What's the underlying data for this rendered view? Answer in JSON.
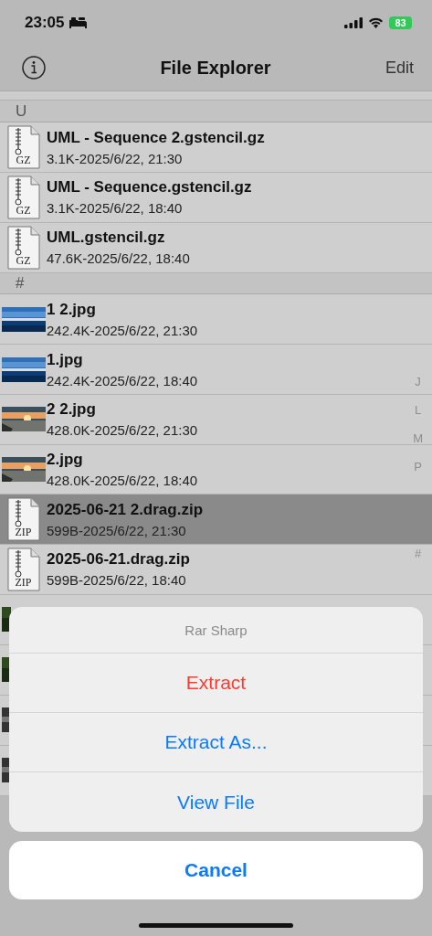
{
  "status_bar": {
    "time": "23:05",
    "battery": "83"
  },
  "nav": {
    "title": "File Explorer",
    "edit": "Edit"
  },
  "sections": [
    {
      "header": "U",
      "items": [
        {
          "kind": "archive",
          "badge": "GZ",
          "name": "UML - Sequence 2.gstencil.gz",
          "meta": "3.1K-2025/6/22, 21:30",
          "selected": false
        },
        {
          "kind": "archive",
          "badge": "GZ",
          "name": "UML - Sequence.gstencil.gz",
          "meta": "3.1K-2025/6/22, 18:40",
          "selected": false
        },
        {
          "kind": "archive",
          "badge": "GZ",
          "name": "UML.gstencil.gz",
          "meta": "47.6K-2025/6/22, 18:40",
          "selected": false
        }
      ]
    },
    {
      "header": "#",
      "items": [
        {
          "kind": "lake",
          "name": "1 2.jpg",
          "meta": "242.4K-2025/6/22, 21:30",
          "selected": false
        },
        {
          "kind": "lake",
          "name": "1.jpg",
          "meta": "242.4K-2025/6/22, 18:40",
          "selected": false
        },
        {
          "kind": "sunset",
          "name": "2 2.jpg",
          "meta": "428.0K-2025/6/22, 21:30",
          "selected": false
        },
        {
          "kind": "sunset",
          "name": "2.jpg",
          "meta": "428.0K-2025/6/22, 18:40",
          "selected": false
        },
        {
          "kind": "archive",
          "badge": "ZIP",
          "name": "2025-06-21 2.drag.zip",
          "meta": "599B-2025/6/22, 21:30",
          "selected": true
        },
        {
          "kind": "archive",
          "badge": "ZIP",
          "name": "2025-06-21.drag.zip",
          "meta": "599B-2025/6/22, 18:40",
          "selected": false
        }
      ]
    }
  ],
  "index": [
    "J",
    "L",
    "M",
    "P",
    "#"
  ],
  "action_sheet": {
    "title": "Rar Sharp",
    "actions": [
      {
        "label": "Extract",
        "kind": "destructive"
      },
      {
        "label": "Extract As...",
        "kind": "default"
      },
      {
        "label": "View File",
        "kind": "default"
      }
    ],
    "cancel": "Cancel"
  }
}
